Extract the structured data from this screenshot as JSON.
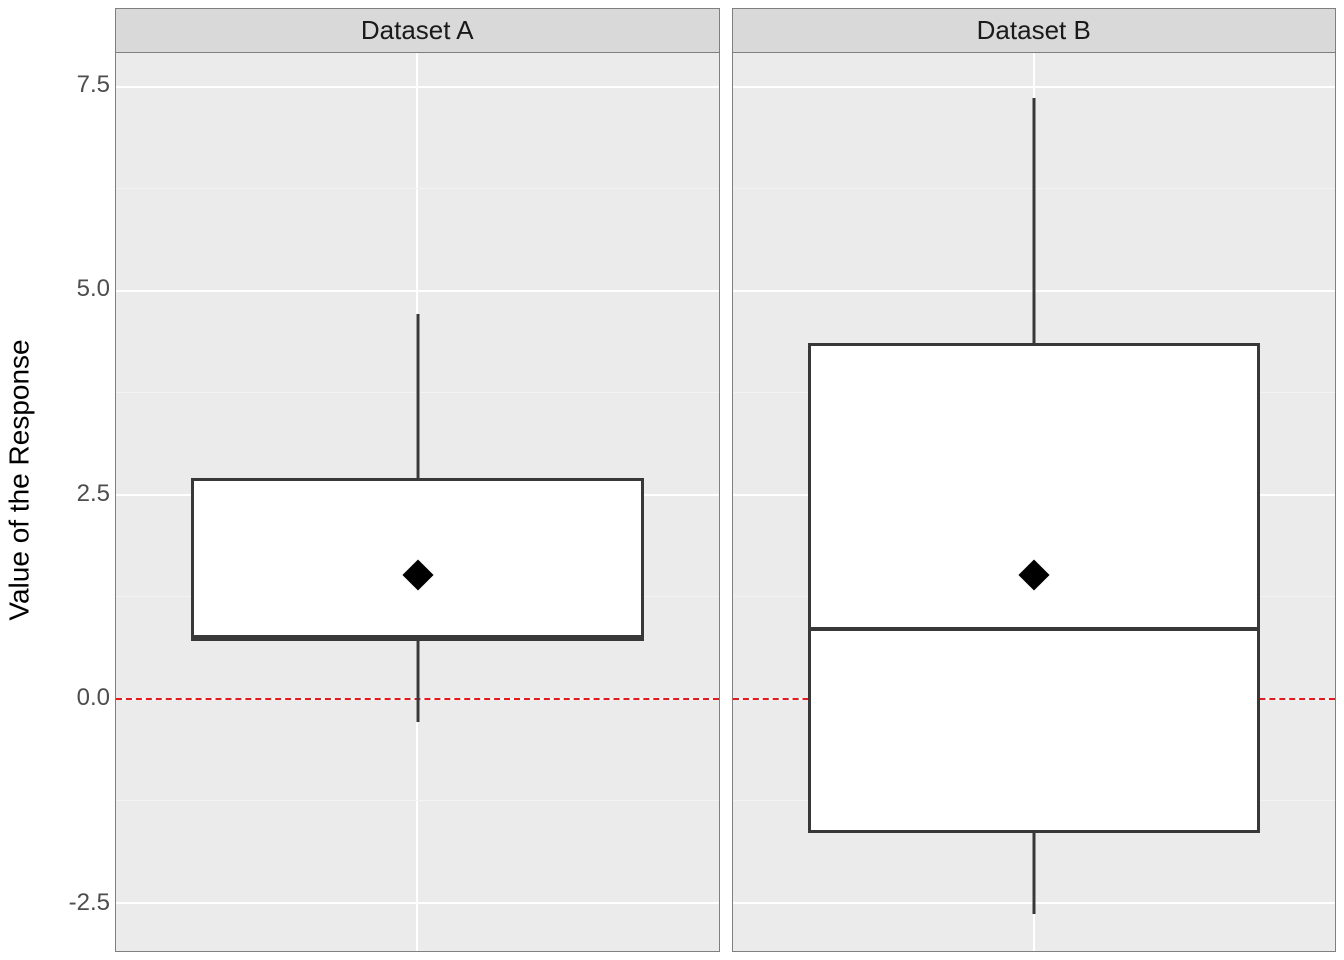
{
  "chart_data": [
    {
      "type": "box",
      "facet": "Dataset A",
      "q1": 0.7,
      "median": 0.75,
      "q3": 2.7,
      "whisker_low": -0.3,
      "whisker_high": 4.7,
      "mean": 1.5
    },
    {
      "type": "box",
      "facet": "Dataset B",
      "q1": -1.65,
      "median": 0.85,
      "q3": 4.35,
      "whisker_low": -2.65,
      "whisker_high": 7.35,
      "mean": 1.5
    }
  ],
  "y_axis": {
    "title": "Value of the Response",
    "ticks": [
      -2.5,
      0.0,
      2.5,
      5.0,
      7.5
    ],
    "tick_labels": [
      "-2.5",
      "0.0",
      "2.5",
      "5.0",
      "7.5"
    ],
    "minor_ticks": [
      -1.25,
      1.25,
      3.75,
      6.25
    ],
    "range_min": -3.1,
    "range_max": 7.9
  },
  "facets": [
    "Dataset A",
    "Dataset B"
  ],
  "reference_line_y": 0,
  "colors": {
    "panel_bg": "#ebebeb",
    "strip_bg": "#d9d9d9",
    "grid": "#ffffff",
    "ref_line": "#e41a1c",
    "box_stroke": "#383838",
    "box_fill": "#ffffff",
    "mean_point": "#000000"
  }
}
